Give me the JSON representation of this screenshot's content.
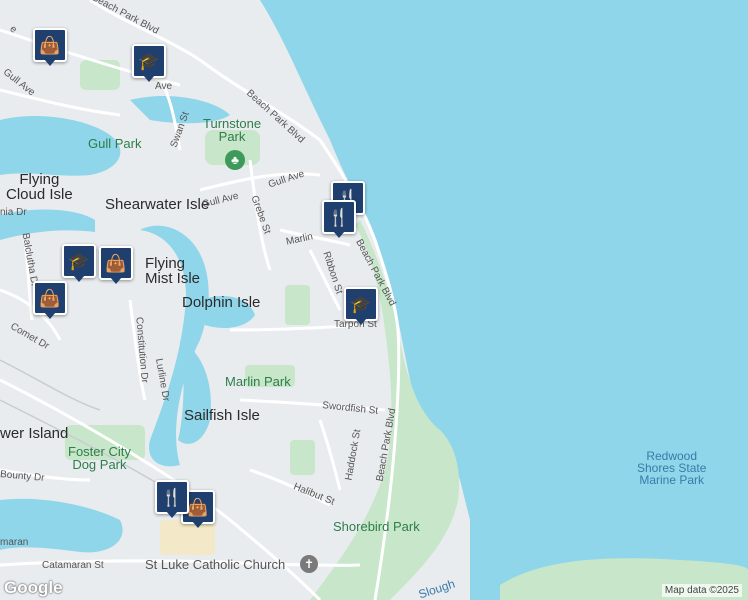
{
  "colors": {
    "water": "#8fd6ea",
    "land": "#e9ecef",
    "park": "#c8e6c9",
    "road": "#ffffff",
    "pin": "#1f3f6e"
  },
  "areas": {
    "flying_cloud_isle": "Flying\nCloud Isle",
    "shearwater_isle": "Shearwater Isle",
    "flying_mist_isle": "Flying\nMist Isle",
    "dolphin_isle": "Dolphin Isle",
    "sailfish_isle": "Sailfish Isle",
    "tower_island": "wer Island"
  },
  "parks": {
    "turnstone_park": "Turnstone\nPark",
    "gull_park": "Gull Park",
    "marlin_park": "Marlin Park",
    "foster_city_dog_park": "Foster City\nDog Park",
    "shorebird_park": "Shorebird Park",
    "redwood_shores": "Redwood\nShores State\nMarine Park"
  },
  "pois": {
    "st_luke": "St Luke Catholic Church",
    "slough": "Slough"
  },
  "streets": {
    "beach_park_blvd_top": "Beach Park Blvd",
    "beach_park_blvd_mid": "Beach Park Blvd",
    "beach_park_blvd_right": "Beach Park Blvd",
    "beach_park_blvd_low": "Beach Park Blvd",
    "gull_ave_1": "Gull Ave",
    "gull_ave_2": "Gull Ave",
    "gull_ave_3": "Gull Ave",
    "ave": "Ave",
    "swan_st": "Swan St",
    "grebe_st": "Grebe St",
    "marlin": "Marlin",
    "ribbon_st": "Ribbon St",
    "tarpon_st": "Tarpon St",
    "swordfish_st": "Swordfish St",
    "haddock_st": "Haddock St",
    "halibut_st": "Halibut St",
    "bounty_dr": "Bounty Dr",
    "catamaran_st": "Catamaran St",
    "catamaran_partial": "maran",
    "constitution_dr": "Constitution Dr",
    "lurline_dr": "Lurline Dr",
    "comet_dr": "Comet Dr",
    "balclutha_dr": "Balclutha Dr",
    "nia_dr": "nia Dr",
    "e_partial": "e"
  },
  "markers": [
    {
      "kind": "shopping",
      "icon": "shopping-bag-icon"
    },
    {
      "kind": "school",
      "icon": "school-icon"
    },
    {
      "kind": "restaurant",
      "icon": "restaurant-icon"
    },
    {
      "kind": "restaurant",
      "icon": "restaurant-icon"
    },
    {
      "kind": "school",
      "icon": "school-icon"
    },
    {
      "kind": "school",
      "icon": "school-icon"
    },
    {
      "kind": "shopping",
      "icon": "shopping-bag-icon"
    },
    {
      "kind": "shopping",
      "icon": "shopping-bag-icon"
    },
    {
      "kind": "shopping",
      "icon": "shopping-bag-icon"
    }
  ],
  "attribution": "Map data ©2025",
  "logo": "Google"
}
